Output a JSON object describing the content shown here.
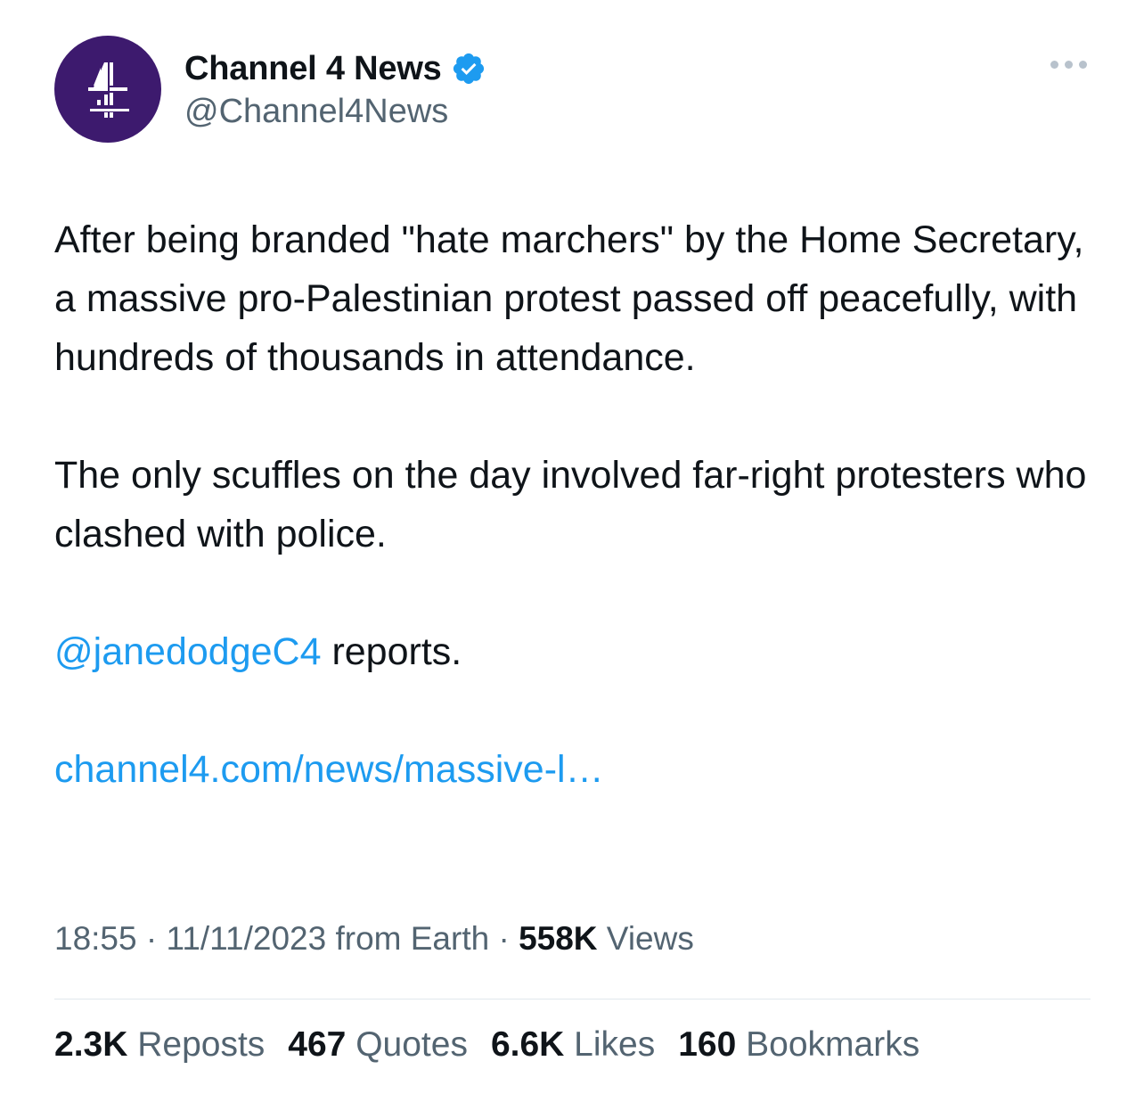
{
  "account": {
    "display_name": "Channel 4 News",
    "handle": "@Channel4News",
    "avatar_icon": "channel4-logo-icon",
    "avatar_color": "#3d1a6e",
    "verified_icon": "verified-badge-icon",
    "verified_color": "#1d9bf0"
  },
  "more_icon": "more-dots-icon",
  "tweet": {
    "paragraph_1": "After being branded \"hate marchers\" by the Home Secretary, a massive pro-Palestinian protest passed off peacefully, with hundreds of thousands in attendance.",
    "paragraph_2": "The only scuffles on the day involved far-right protesters who clashed with police.",
    "mention": "@janedodgeC4",
    "mention_suffix": " reports.",
    "url": "channel4.com/news/massive-l…"
  },
  "meta": {
    "time": "18:55",
    "sep1": " · ",
    "date": "11/11/2023",
    "source": " from Earth",
    "sep2": " · ",
    "views_count": "558K",
    "views_label": " Views"
  },
  "stats": {
    "reposts_count": "2.3K",
    "reposts_label": " Reposts",
    "quotes_count": "467",
    "quotes_label": " Quotes",
    "likes_count": "6.6K",
    "likes_label": " Likes",
    "bookmarks_count": "160",
    "bookmarks_label": " Bookmarks"
  },
  "colors": {
    "text": "#0f1419",
    "secondary": "#536471",
    "link": "#1d9bf0"
  }
}
